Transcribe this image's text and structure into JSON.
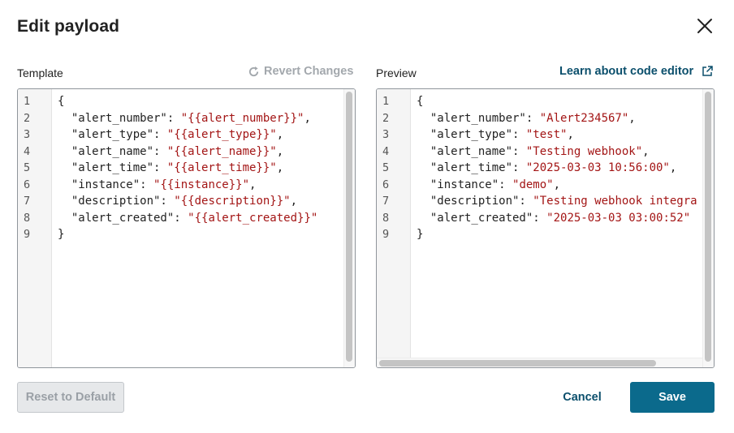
{
  "dialog": {
    "title": "Edit payload"
  },
  "template": {
    "label": "Template",
    "revert_label": "Revert Changes",
    "lines": [
      {
        "n": "1",
        "parts": [
          {
            "t": "{",
            "s": false
          }
        ]
      },
      {
        "n": "2",
        "parts": [
          {
            "t": "  \"alert_number\": ",
            "s": false
          },
          {
            "t": "\"{{alert_number}}\"",
            "s": true
          },
          {
            "t": ",",
            "s": false
          }
        ]
      },
      {
        "n": "3",
        "parts": [
          {
            "t": "  \"alert_type\": ",
            "s": false
          },
          {
            "t": "\"{{alert_type}}\"",
            "s": true
          },
          {
            "t": ",",
            "s": false
          }
        ]
      },
      {
        "n": "4",
        "parts": [
          {
            "t": "  \"alert_name\": ",
            "s": false
          },
          {
            "t": "\"{{alert_name}}\"",
            "s": true
          },
          {
            "t": ",",
            "s": false
          }
        ]
      },
      {
        "n": "5",
        "parts": [
          {
            "t": "  \"alert_time\": ",
            "s": false
          },
          {
            "t": "\"{{alert_time}}\"",
            "s": true
          },
          {
            "t": ",",
            "s": false
          }
        ]
      },
      {
        "n": "6",
        "parts": [
          {
            "t": "  \"instance\": ",
            "s": false
          },
          {
            "t": "\"{{instance}}\"",
            "s": true
          },
          {
            "t": ",",
            "s": false
          }
        ]
      },
      {
        "n": "7",
        "parts": [
          {
            "t": "  \"description\": ",
            "s": false
          },
          {
            "t": "\"{{description}}\"",
            "s": true
          },
          {
            "t": ",",
            "s": false
          }
        ]
      },
      {
        "n": "8",
        "parts": [
          {
            "t": "  \"alert_created\": ",
            "s": false
          },
          {
            "t": "\"{{alert_created}}\"",
            "s": true
          }
        ]
      },
      {
        "n": "9",
        "parts": [
          {
            "t": "}",
            "s": false
          }
        ]
      }
    ]
  },
  "preview": {
    "label": "Preview",
    "learn_label": "Learn about code editor",
    "lines": [
      {
        "n": "1",
        "parts": [
          {
            "t": "{",
            "s": false
          }
        ]
      },
      {
        "n": "2",
        "parts": [
          {
            "t": "  \"alert_number\": ",
            "s": false
          },
          {
            "t": "\"Alert234567\"",
            "s": true
          },
          {
            "t": ",",
            "s": false
          }
        ]
      },
      {
        "n": "3",
        "parts": [
          {
            "t": "  \"alert_type\": ",
            "s": false
          },
          {
            "t": "\"test\"",
            "s": true
          },
          {
            "t": ",",
            "s": false
          }
        ]
      },
      {
        "n": "4",
        "parts": [
          {
            "t": "  \"alert_name\": ",
            "s": false
          },
          {
            "t": "\"Testing webhook\"",
            "s": true
          },
          {
            "t": ",",
            "s": false
          }
        ]
      },
      {
        "n": "5",
        "parts": [
          {
            "t": "  \"alert_time\": ",
            "s": false
          },
          {
            "t": "\"2025-03-03 10:56:00\"",
            "s": true
          },
          {
            "t": ",",
            "s": false
          }
        ]
      },
      {
        "n": "6",
        "parts": [
          {
            "t": "  \"instance\": ",
            "s": false
          },
          {
            "t": "\"demo\"",
            "s": true
          },
          {
            "t": ",",
            "s": false
          }
        ]
      },
      {
        "n": "7",
        "parts": [
          {
            "t": "  \"description\": ",
            "s": false
          },
          {
            "t": "\"Testing webhook integra",
            "s": true
          }
        ]
      },
      {
        "n": "8",
        "parts": [
          {
            "t": "  \"alert_created\": ",
            "s": false
          },
          {
            "t": "\"2025-03-03 03:00:52\"",
            "s": true
          }
        ]
      },
      {
        "n": "9",
        "parts": [
          {
            "t": "}",
            "s": false
          }
        ]
      }
    ]
  },
  "footer": {
    "reset_label": "Reset to Default",
    "cancel_label": "Cancel",
    "save_label": "Save"
  },
  "icons": {
    "close": "close-icon",
    "revert": "refresh-icon",
    "external": "external-link-icon"
  },
  "colors": {
    "accent": "#0b4f6c",
    "primary_button": "#0b6a8c",
    "string": "#a31515"
  }
}
